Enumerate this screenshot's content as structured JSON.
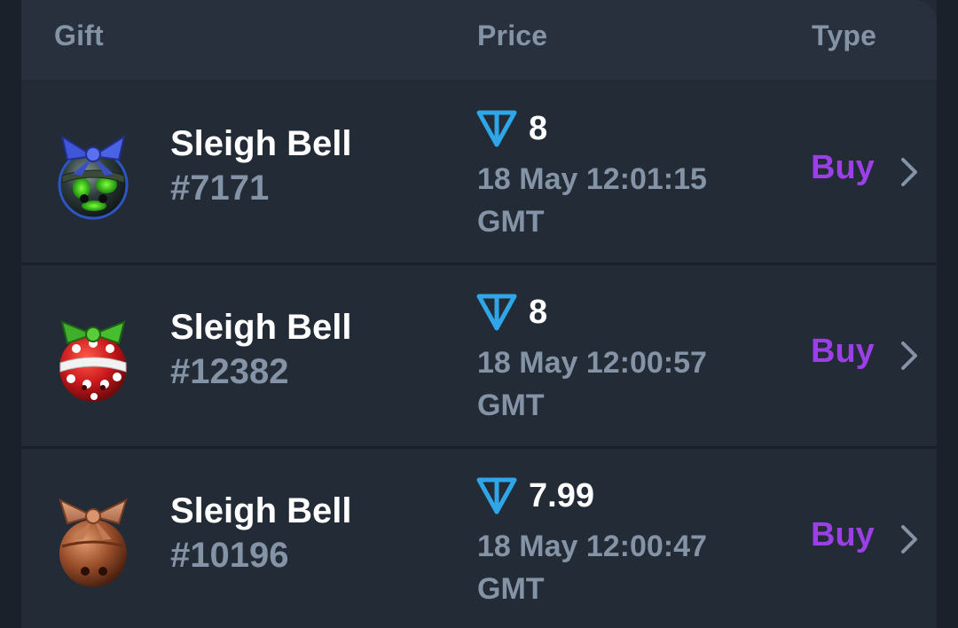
{
  "header": {
    "gift_label": "Gift",
    "price_label": "Price",
    "type_label": "Type"
  },
  "rows": [
    {
      "name": "Sleigh Bell",
      "number": "#7171",
      "price": "8",
      "date": "18 May 12:01:15",
      "tz": "GMT",
      "type": "Buy",
      "icon": "sleigh-bell-green-icon"
    },
    {
      "name": "Sleigh Bell",
      "number": "#12382",
      "price": "8",
      "date": "18 May 12:00:57",
      "tz": "GMT",
      "type": "Buy",
      "icon": "sleigh-bell-red-dots-icon"
    },
    {
      "name": "Sleigh Bell",
      "number": "#10196",
      "price": "7.99",
      "date": "18 May 12:00:47",
      "tz": "GMT",
      "type": "Buy",
      "icon": "sleigh-bell-copper-icon"
    }
  ],
  "colors": {
    "accent_buy": "#9b3fe6",
    "ton_blue": "#2ea6e8",
    "muted": "#8593a6"
  }
}
